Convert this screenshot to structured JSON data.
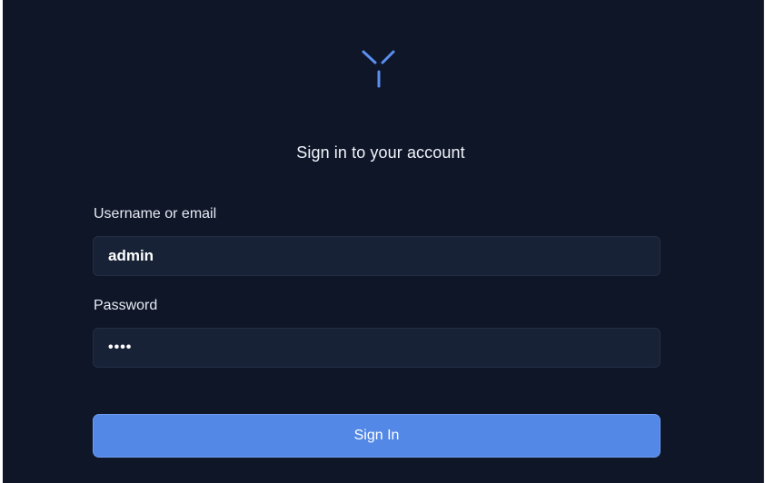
{
  "brand": {
    "logo_icon": "y-logo-icon",
    "accent_color": "#5b8ff0"
  },
  "form": {
    "title": "Sign in to your account",
    "username_label": "Username or email",
    "username_value": "admin",
    "password_label": "Password",
    "password_value": "••••",
    "submit_label": "Sign In"
  }
}
